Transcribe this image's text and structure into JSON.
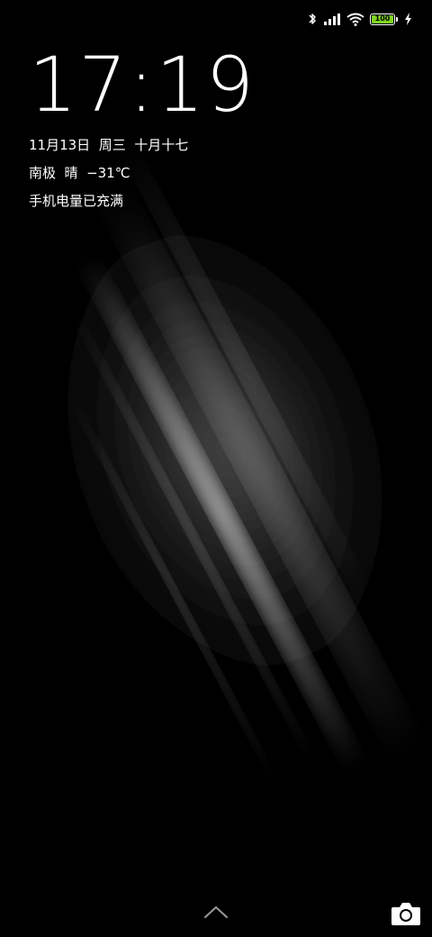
{
  "status_bar": {
    "icons": [
      "bluetooth-icon",
      "signal-icon",
      "wifi-icon",
      "battery-icon",
      "charging-bolt-icon"
    ],
    "battery_level": "100",
    "battery_color": "#7ed321"
  },
  "lockscreen": {
    "time": "17:19",
    "date_line": "11月13日  周三  十月十七",
    "weather_line": "南极  晴  −31℃",
    "charge_status": "手机电量已充满"
  },
  "bottom": {
    "icons": [
      "chevron-up-icon",
      "camera-icon"
    ]
  }
}
